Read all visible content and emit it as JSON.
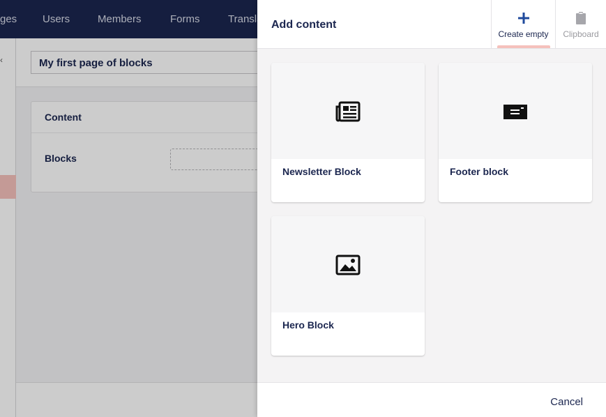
{
  "nav": {
    "items": [
      "ges",
      "Users",
      "Members",
      "Forms",
      "Transla"
    ]
  },
  "editor": {
    "document_name": "My first page of blocks",
    "panel_title": "Content",
    "blocks_label": "Blocks"
  },
  "dialog": {
    "title": "Add content",
    "actions": {
      "create_empty": "Create empty",
      "clipboard": "Clipboard"
    },
    "blocks": [
      {
        "label": "Newsletter Block",
        "icon": "newspaper-icon"
      },
      {
        "label": "Footer block",
        "icon": "card-icon"
      },
      {
        "label": "Hero Block",
        "icon": "picture-icon"
      }
    ],
    "cancel_label": "Cancel"
  },
  "colors": {
    "nav_bg": "#1b264f",
    "accent_pink": "#f5c1bc",
    "text_dark": "#1b264f"
  }
}
